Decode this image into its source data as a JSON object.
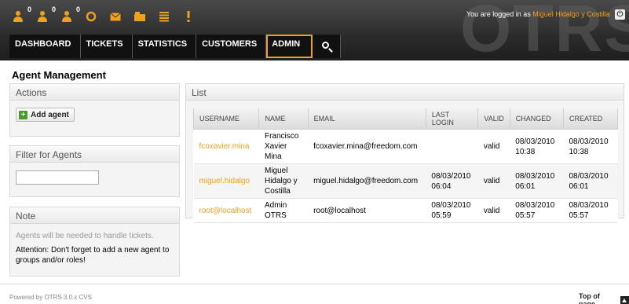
{
  "header": {
    "logo_text": "OTRS",
    "logged_in_prefix": "You are logged in as",
    "logged_in_user": "Miguel Hidalgo y Costilla",
    "toolbar_badges": [
      "0",
      "0",
      "0"
    ],
    "power_icon": "⏻"
  },
  "nav": {
    "items": [
      {
        "label": "DASHBOARD"
      },
      {
        "label": "TICKETS"
      },
      {
        "label": "STATISTICS"
      },
      {
        "label": "CUSTOMERS"
      },
      {
        "label": "ADMIN"
      }
    ]
  },
  "page": {
    "title": "Agent Management"
  },
  "actions": {
    "header": "Actions",
    "add_agent_label": "Add agent"
  },
  "filter": {
    "header": "Filter for Agents",
    "value": ""
  },
  "note": {
    "header": "Note",
    "muted_text": "Agents will be needed to handle tickets.",
    "attention_text": "Attention: Don't forget to add a new agent to groups and/or roles!"
  },
  "list": {
    "header": "List",
    "columns": [
      "USERNAME",
      "NAME",
      "EMAIL",
      "LAST LOGIN",
      "VALID",
      "CHANGED",
      "CREATED"
    ],
    "rows": [
      {
        "username": "fcoxavier.mina",
        "name_lines": [
          "Francisco",
          "Xavier",
          "Mina"
        ],
        "email": "fcoxavier.mina@freedom.com",
        "last_login_lines": [],
        "valid": "valid",
        "changed_lines": [
          "08/03/2010",
          "10:38"
        ],
        "created_lines": [
          "08/03/2010",
          "10:38"
        ]
      },
      {
        "username": "miguel.hidalgo",
        "name_lines": [
          "Miguel",
          "Hidalgo y",
          "Costilla"
        ],
        "email": "miguel.hidalgo@freedom.com",
        "last_login_lines": [
          "08/03/2010",
          "06:04"
        ],
        "valid": "valid",
        "changed_lines": [
          "08/03/2010",
          "06:01"
        ],
        "created_lines": [
          "08/03/2010",
          "06:01"
        ]
      },
      {
        "username": "root@localhost",
        "name_lines": [
          "Admin",
          "OTRS"
        ],
        "email": "root@localhost",
        "last_login_lines": [
          "08/03/2010",
          "05:59"
        ],
        "valid": "valid",
        "changed_lines": [
          "08/03/2010",
          "05:57"
        ],
        "created_lines": [
          "08/03/2010",
          "05:57"
        ]
      }
    ]
  },
  "footer": {
    "powered_by": "Powered by OTRS 3.0.x CVS",
    "top_of_page": "Top of page"
  }
}
